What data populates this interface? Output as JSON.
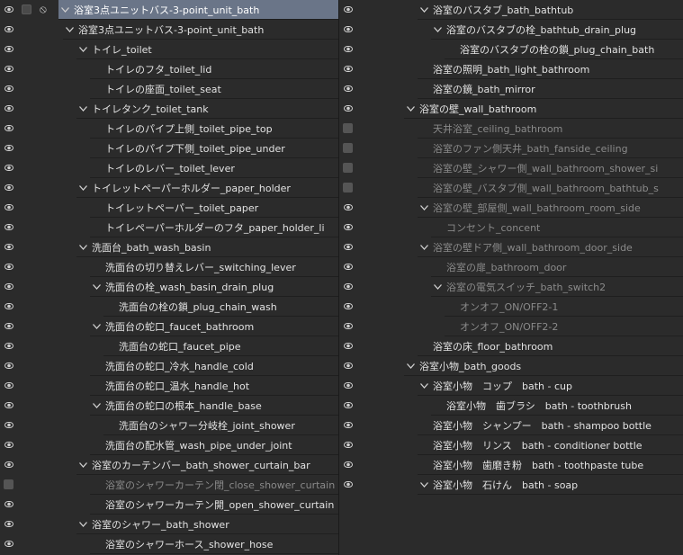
{
  "left_panel": [
    {
      "name": "浴室3点ユニットバス-3-point_unit_bath",
      "depth": 0,
      "exp": true,
      "vis": true,
      "selected": true,
      "extras": true
    },
    {
      "name": "浴室3点ユニットバス-3-point_unit_bath",
      "depth": 1,
      "exp": true,
      "vis": true
    },
    {
      "name": "トイレ_toilet",
      "depth": 2,
      "exp": true,
      "vis": true
    },
    {
      "name": "トイレのフタ_toilet_lid",
      "depth": 3,
      "exp": null,
      "vis": true
    },
    {
      "name": "トイレの座面_toilet_seat",
      "depth": 3,
      "exp": null,
      "vis": true
    },
    {
      "name": "トイレタンク_toilet_tank",
      "depth": 2,
      "exp": true,
      "vis": true
    },
    {
      "name": "トイレのパイプ上側_toilet_pipe_top",
      "depth": 3,
      "exp": null,
      "vis": true
    },
    {
      "name": "トイレのパイプ下側_toilet_pipe_under",
      "depth": 3,
      "exp": null,
      "vis": true
    },
    {
      "name": "トイレのレバー_toilet_lever",
      "depth": 3,
      "exp": null,
      "vis": true
    },
    {
      "name": "トイレットペーパーホルダー_paper_holder",
      "depth": 2,
      "exp": true,
      "vis": true
    },
    {
      "name": "トイレットペーパー_toilet_paper",
      "depth": 3,
      "exp": null,
      "vis": true
    },
    {
      "name": "トイレペーパーホルダーのフタ_paper_holder_li",
      "depth": 3,
      "exp": null,
      "vis": true
    },
    {
      "name": "洗面台_bath_wash_basin",
      "depth": 2,
      "exp": true,
      "vis": true
    },
    {
      "name": "洗面台の切り替えレバー_switching_lever",
      "depth": 3,
      "exp": null,
      "vis": true
    },
    {
      "name": "洗面台の栓_wash_basin_drain_plug",
      "depth": 3,
      "exp": true,
      "vis": true
    },
    {
      "name": "洗面台の栓の鎖_plug_chain_wash",
      "depth": 4,
      "exp": null,
      "vis": true
    },
    {
      "name": "洗面台の蛇口_faucet_bathroom",
      "depth": 3,
      "exp": true,
      "vis": true
    },
    {
      "name": "洗面台の蛇口_faucet_pipe",
      "depth": 4,
      "exp": null,
      "vis": true
    },
    {
      "name": "洗面台の蛇口_冷水_handle_cold",
      "depth": 3,
      "exp": null,
      "vis": true
    },
    {
      "name": "洗面台の蛇口_温水_handle_hot",
      "depth": 3,
      "exp": null,
      "vis": true
    },
    {
      "name": "洗面台の蛇口の根本_handle_base",
      "depth": 3,
      "exp": true,
      "vis": true
    },
    {
      "name": "洗面台のシャワー分岐栓_joint_shower",
      "depth": 4,
      "exp": null,
      "vis": true
    },
    {
      "name": "洗面台の配水管_wash_pipe_under_joint",
      "depth": 3,
      "exp": null,
      "vis": true
    },
    {
      "name": "浴室のカーテンバー_bath_shower_curtain_bar",
      "depth": 2,
      "exp": true,
      "vis": true
    },
    {
      "name": "浴室のシャワーカーテン閉_close_shower_curtain",
      "depth": 3,
      "exp": null,
      "vis": false,
      "dim": true
    },
    {
      "name": "浴室のシャワーカーテン開_open_shower_curtain",
      "depth": 3,
      "exp": null,
      "vis": true
    },
    {
      "name": "浴室のシャワー_bath_shower",
      "depth": 2,
      "exp": true,
      "vis": true
    },
    {
      "name": "浴室のシャワーホース_shower_hose",
      "depth": 3,
      "exp": null,
      "vis": true
    }
  ],
  "right_panel": [
    {
      "name": "浴室のバスタブ_bath_bathtub",
      "depth": 1,
      "exp": true,
      "vis": true
    },
    {
      "name": "浴室のバスタブの栓_bathtub_drain_plug",
      "depth": 2,
      "exp": true,
      "vis": true
    },
    {
      "name": "浴室のバスタブの栓の鎖_plug_chain_bath",
      "depth": 3,
      "exp": null,
      "vis": true
    },
    {
      "name": "浴室の照明_bath_light_bathroom",
      "depth": 1,
      "exp": null,
      "vis": true
    },
    {
      "name": "浴室の鏡_bath_mirror",
      "depth": 1,
      "exp": null,
      "vis": true
    },
    {
      "name": "浴室の壁_wall_bathroom",
      "depth": 0,
      "exp": true,
      "vis": true
    },
    {
      "name": "天井浴室_ceiling_bathroom",
      "depth": 1,
      "exp": null,
      "vis": false,
      "dim": true
    },
    {
      "name": "浴室のファン側天井_bath_fanside_ceiling",
      "depth": 1,
      "exp": null,
      "vis": false,
      "dim": true
    },
    {
      "name": "浴室の壁_シャワー側_wall_bathroom_shower_si",
      "depth": 1,
      "exp": null,
      "vis": false,
      "dim": true
    },
    {
      "name": "浴室の壁_バスタブ側_wall_bathroom_bathtub_s",
      "depth": 1,
      "exp": null,
      "vis": false,
      "dim": true
    },
    {
      "name": "浴室の壁_部屋側_wall_bathroom_room_side",
      "depth": 1,
      "exp": true,
      "vis": true,
      "dim": true
    },
    {
      "name": "コンセント_concent",
      "depth": 2,
      "exp": null,
      "vis": true,
      "dim": true
    },
    {
      "name": "浴室の壁ドア側_wall_bathroom_door_side",
      "depth": 1,
      "exp": true,
      "vis": true,
      "dim": true
    },
    {
      "name": "浴室の扉_bathroom_door",
      "depth": 2,
      "exp": null,
      "vis": true,
      "dim": true
    },
    {
      "name": "浴室の電気スイッチ_bath_switch2",
      "depth": 2,
      "exp": true,
      "vis": true,
      "dim": true
    },
    {
      "name": "オンオフ_ON/OFF2-1",
      "depth": 3,
      "exp": null,
      "vis": true,
      "dim": true
    },
    {
      "name": "オンオフ_ON/OFF2-2",
      "depth": 3,
      "exp": null,
      "vis": true,
      "dim": true
    },
    {
      "name": "浴室の床_floor_bathroom",
      "depth": 1,
      "exp": null,
      "vis": true
    },
    {
      "name": "浴室小物_bath_goods",
      "depth": 0,
      "exp": true,
      "vis": true
    },
    {
      "name": "浴室小物　コップ　bath - cup",
      "depth": 1,
      "exp": true,
      "vis": true
    },
    {
      "name": "浴室小物　歯ブラシ　bath - toothbrush",
      "depth": 2,
      "exp": null,
      "vis": true
    },
    {
      "name": "浴室小物　シャンプー　bath - shampoo bottle",
      "depth": 1,
      "exp": null,
      "vis": true
    },
    {
      "name": "浴室小物　リンス　bath - conditioner bottle",
      "depth": 1,
      "exp": null,
      "vis": true
    },
    {
      "name": "浴室小物　歯磨き粉　bath - toothpaste tube",
      "depth": 1,
      "exp": null,
      "vis": true
    },
    {
      "name": "浴室小物　石けん　bath - soap",
      "depth": 1,
      "exp": true,
      "vis": true
    }
  ],
  "icons": {
    "visibility": "eye-icon",
    "hidden": "hidden-box-icon",
    "expander": "chevron-down-icon",
    "lock": "lock-cursor-icon"
  },
  "colors": {
    "background": "#2b2b2b",
    "selected_row": "#6a7588",
    "text": "#e2e2e2",
    "dim_text": "#8a8a8a"
  }
}
